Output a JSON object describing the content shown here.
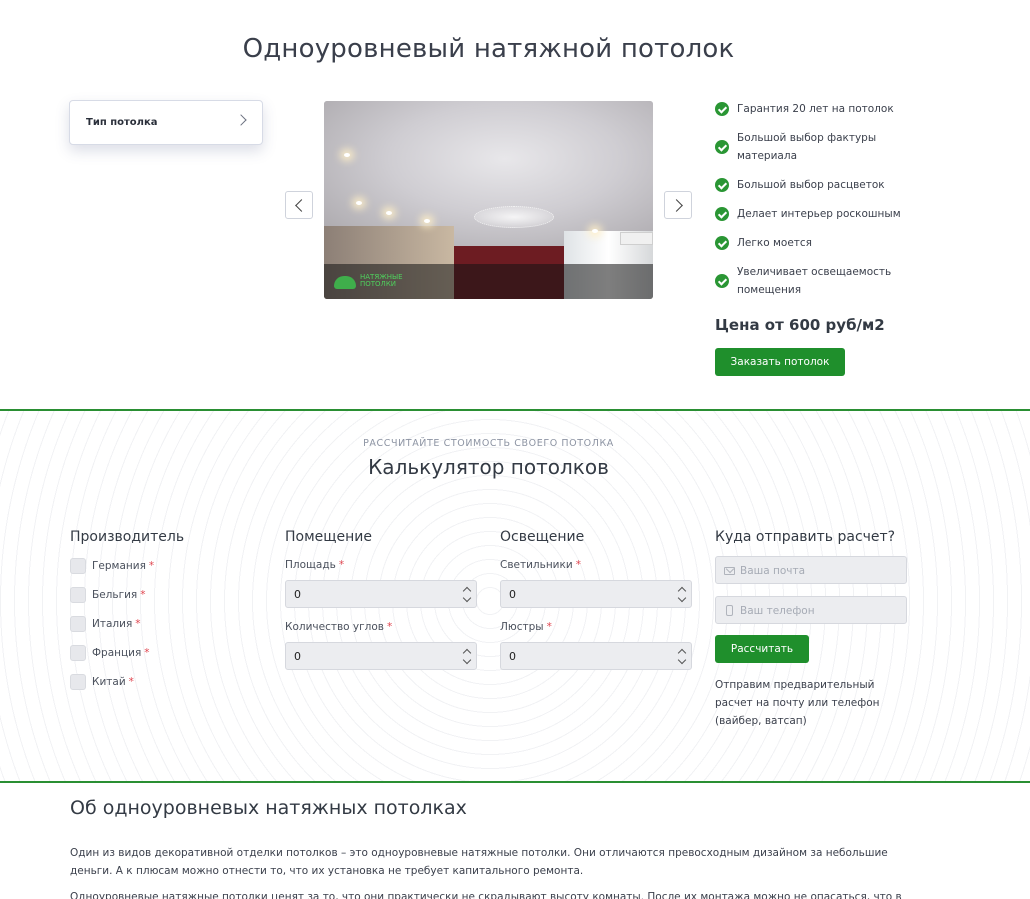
{
  "hero": {
    "title": "Одноуровневый натяжной потолок",
    "type_card_label": "Тип потолка",
    "image_logo_text": "НАТЯЖНЫЕ ПОТОЛКИ",
    "benefits": [
      "Гарантия 20 лет на потолок",
      "Большой выбор фактуры материала",
      "Большой выбор расцветок",
      "Делает интерьер роскошным",
      "Легко моется",
      "Увеличивает освещаемость помещения"
    ],
    "price": "Цена от 600 руб/м2",
    "order_button": "Заказать потолок"
  },
  "calculator": {
    "eyebrow": "РАССЧИТАЙТЕ СТОИМОСТЬ СВОЕГО ПОТОЛКА",
    "title": "Калькулятор потолков",
    "manufacturer": {
      "title": "Производитель",
      "options": [
        "Германия",
        "Бельгия",
        "Италия",
        "Франция",
        "Китай"
      ],
      "required_mark": "*"
    },
    "room": {
      "title": "Помещение",
      "area_label": "Площадь",
      "area_value": "0",
      "corners_label": "Количество углов",
      "corners_value": "0",
      "required_mark": "*"
    },
    "lighting": {
      "title": "Освещение",
      "lamps_label": "Светильники",
      "lamps_value": "0",
      "chandeliers_label": "Люстры",
      "chandeliers_value": "0",
      "required_mark": "*"
    },
    "send": {
      "title": "Куда отправить расчет?",
      "email_placeholder": "Ваша почта",
      "phone_placeholder": "Ваш телефон",
      "button": "Рассчитать",
      "note": "Отправим предварительный расчет на почту или телефон (вайбер, ватсап)"
    }
  },
  "about": {
    "title": "Об одноуровневых натяжных потолках",
    "paragraph1": "Один из видов декоративной отделки потолков – это одноуровневые натяжные потолки. Они отличаются превосходным дизайном за небольшие деньги. А к плюсам можно отнести то, что их установка не требует капитального ремонта.",
    "paragraph2": "Одноуровневые натяжные потолки ценят за то, что они практически не скрадывают высоту комнаты. После их монтажа можно не опасаться, что в комнате"
  },
  "colors": {
    "accent_green": "#1f8f2c",
    "divider_green": "#2a8f33",
    "check_green": "#2a9634",
    "required_red": "#e0454f"
  }
}
